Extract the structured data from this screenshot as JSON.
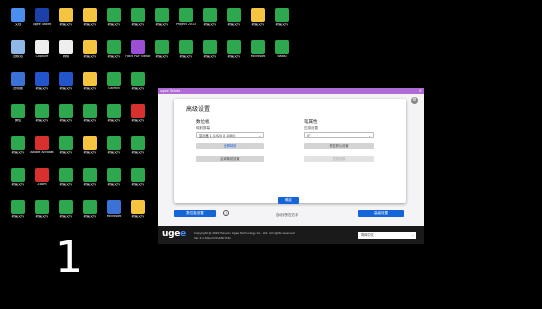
{
  "desktop": {
    "overlay_number": "1",
    "icons": [
      {
        "label": "文档",
        "color": "#4a8ef0"
      },
      {
        "label": "ugee Tablet",
        "color": "#1c3fa8"
      },
      {
        "label": "新建文件",
        "color": "#f5c542"
      },
      {
        "label": "新建文件",
        "color": "#f5c542"
      },
      {
        "label": "新建文件",
        "color": "#2ea84f"
      },
      {
        "label": "新建文件",
        "color": "#2ea84f"
      },
      {
        "label": "新建文件",
        "color": "#2ea84f"
      },
      {
        "label": "Project 2013",
        "color": "#2ea84f"
      },
      {
        "label": "新建文件",
        "color": "#2ea84f"
      },
      {
        "label": "新建文件",
        "color": "#2ea84f"
      },
      {
        "label": "新建文件",
        "color": "#f5c542"
      },
      {
        "label": "新建文件",
        "color": "#2ea84f"
      },
      {
        "label": "回收站",
        "color": "#8fb7e8"
      },
      {
        "label": "Capture",
        "color": "#eeeeee"
      },
      {
        "label": "网络",
        "color": "#eeeeee"
      },
      {
        "label": "新建文件",
        "color": "#f5c542"
      },
      {
        "label": "新建文件",
        "color": "#2ea84f"
      },
      {
        "label": "Foxit PDF Editor",
        "color": "#9a4fd6"
      },
      {
        "label": "新建文件",
        "color": "#2ea84f"
      },
      {
        "label": "新建文件",
        "color": "#2ea84f"
      },
      {
        "label": "新建文件",
        "color": "#2ea84f"
      },
      {
        "label": "新建文件",
        "color": "#2ea84f"
      },
      {
        "label": "Microsoft",
        "color": "#2ea84f"
      },
      {
        "label": "Baidu",
        "color": "#2ea84f"
      },
      {
        "label": "此电脑",
        "color": "#3a72d8"
      },
      {
        "label": "新建文件",
        "color": "#2255cc"
      },
      {
        "label": "新建文件",
        "color": "#2255cc"
      },
      {
        "label": "新建文件",
        "color": "#f5c542"
      },
      {
        "label": "Garmin",
        "color": "#2ea84f"
      },
      {
        "label": "新建文件",
        "color": "#2ea84f"
      },
      {
        "label": "新建文件",
        "color": "#2ea84f"
      },
      {
        "label": "新建文件",
        "color": "#2ea84f"
      },
      {
        "label": "新建文件",
        "color": "#2ea84f"
      },
      {
        "label": "新建文件",
        "color": "#2ea84f"
      },
      {
        "label": "控制面板",
        "color": "#4a8ef0"
      },
      {
        "label": "Edge",
        "color": "#1d9ad6"
      },
      {
        "label": "微信",
        "color": "#2ea84f"
      },
      {
        "label": "新建文件",
        "color": "#2ea84f"
      },
      {
        "label": "新建文件",
        "color": "#2ea84f"
      },
      {
        "label": "新建文件",
        "color": "#2ea84f"
      },
      {
        "label": "新建文件",
        "color": "#2ea84f"
      },
      {
        "label": "新建文件",
        "color": "#d6312f"
      },
      {
        "label": "工具",
        "color": "#3a72d8"
      },
      {
        "label": "新建文件",
        "color": "#2a2a2a"
      },
      {
        "label": "新建文件",
        "color": "#2ea84f"
      },
      {
        "label": "新建文件",
        "color": "#2ea84f"
      },
      {
        "label": "新建文件",
        "color": "#2ea84f"
      },
      {
        "label": "新建文件",
        "color": "#2ea84f"
      },
      {
        "label": "新建文件",
        "color": "#2ea84f"
      },
      {
        "label": "Adobe Acrobat",
        "color": "#d6312f"
      },
      {
        "label": "新建文件",
        "color": "#2ea84f"
      },
      {
        "label": "新建文件",
        "color": "#f5c542"
      },
      {
        "label": "新建文件",
        "color": "#2ea84f"
      },
      {
        "label": "新建文件",
        "color": "#2ea84f"
      },
      {
        "label": "新建文件",
        "color": "#2ea84f"
      },
      {
        "label": "CAD",
        "color": "#d6312f"
      },
      {
        "label": "新建文件",
        "color": "#3a72d8"
      },
      {
        "label": "新建文件",
        "color": "#f5c542"
      },
      {
        "label": "新建文件",
        "color": "#2ea84f"
      },
      {
        "label": "新建文件",
        "color": "#2a2a2a"
      },
      {
        "label": "新建文件",
        "color": "#2ea84f"
      },
      {
        "label": "Zoom",
        "color": "#d6312f"
      },
      {
        "label": "新建文件",
        "color": "#2ea84f"
      },
      {
        "label": "新建文件",
        "color": "#2ea84f"
      },
      {
        "label": "新建文件",
        "color": "#2ea84f"
      },
      {
        "label": "新建文件",
        "color": "#2ea84f"
      },
      {
        "label": "新建文件",
        "color": "#3a72d8"
      },
      {
        "label": "Outlook",
        "color": "#3a72d8"
      },
      {
        "label": "新建文件",
        "color": "#f5c542"
      },
      {
        "label": "新建文件",
        "color": "#3a72d8"
      },
      {
        "label": "新建文件",
        "color": "#2a2a2a"
      },
      {
        "label": "新建文件",
        "color": "#2ea84f"
      },
      {
        "label": "新建文件",
        "color": "#2ea84f"
      },
      {
        "label": "新建文件",
        "color": "#2ea84f"
      },
      {
        "label": "新建文件",
        "color": "#2ea84f"
      },
      {
        "label": "新建文件",
        "color": "#2ea84f"
      },
      {
        "label": "Microsoft",
        "color": "#3a72d8"
      },
      {
        "label": "新建文件",
        "color": "#f5c542"
      },
      {
        "label": "新建文件",
        "color": "#2ea84f"
      },
      {
        "label": "新建文件",
        "color": "#2ea84f"
      },
      {
        "label": "新建文件",
        "color": "#2ea84f"
      },
      {
        "label": "新建文件",
        "color": "#2ea84f"
      }
    ]
  },
  "window": {
    "title": "ugee Tablet",
    "close_glyph": "×",
    "gear_glyph": "⚙",
    "panel": {
      "title": "高级设置",
      "left": {
        "heading": "数位板",
        "sub_label": "映射屏幕",
        "select_value": "显示器 1 (1920 X 1080)",
        "button_1": "全屏映射",
        "button_2": "区域映射设置"
      },
      "right": {
        "heading": "笔属性",
        "sub_label": "压感设置",
        "select_value": "0°",
        "button_1": "恢复默认设置",
        "button_2": "压感设置"
      },
      "ok_label": "确定"
    },
    "footer": {
      "left_button": "数位板设置",
      "help_glyph": "?",
      "mid_text": "自动识别左右手",
      "right_button": "高级设置"
    },
    "brand": {
      "logo_main": "uge",
      "logo_accent": "e",
      "copyright_1": "Copyright @ 2020 Hanvon Ugee Technology Co., Ltd. All rights reserved",
      "copyright_2": "Ver 4.1.0(build 0xb3b716)",
      "language": "简体中文",
      "language_arrow": "⌄"
    },
    "colors": {
      "titlebar": "#b16bd6",
      "primary": "#1565d8",
      "brandbar": "#1a1a1a"
    }
  }
}
